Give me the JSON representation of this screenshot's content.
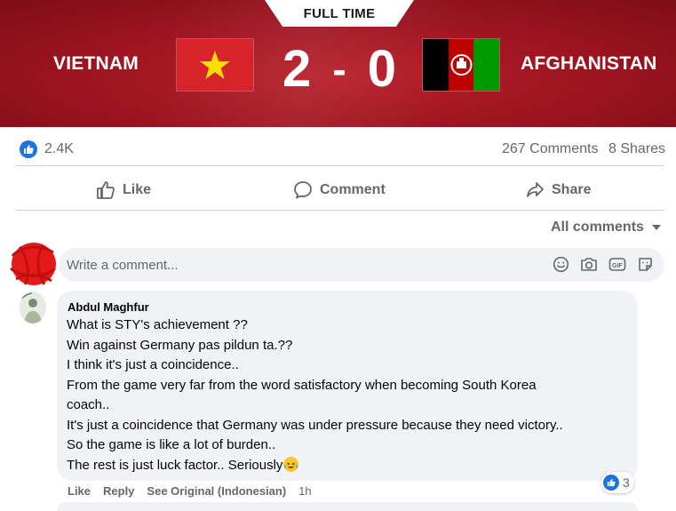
{
  "scoreboard": {
    "status": "FULL TIME",
    "home_team": "VIETNAM",
    "away_team": "AFGHANISTAN",
    "home_score": "2",
    "separator": "-",
    "away_score": "0",
    "colors": {
      "banner": "#9c1420",
      "vietnam_flag_red": "#d8232a",
      "vietnam_flag_star": "#ffde00",
      "afghan_black": "#000000",
      "afghan_red": "#be0000",
      "afghan_green": "#009900"
    }
  },
  "post_stats": {
    "likes": "2.4K",
    "comments": "267 Comments",
    "shares": "8 Shares",
    "like_icon": "thumbs-up-icon",
    "accent": "#1b74e4"
  },
  "actions": {
    "like_label": "Like",
    "comment_label": "Comment",
    "share_label": "Share"
  },
  "comments_section": {
    "sort_label": "All comments",
    "write_placeholder": "Write a comment...",
    "write_icons": [
      "emoji-icon",
      "camera-icon",
      "gif-icon",
      "sticker-icon"
    ]
  },
  "comment": {
    "author": "Abdul Maghfur",
    "lines": [
      "What is STY's achievement ??",
      "Win against Germany pas pildun ta.??",
      "I think it's just a coincidence..",
      "From the game very far from the word satisfactory when becoming South Korea",
      "coach..",
      "It's just a coincidence that Germany was under pressure because they need victory..",
      "So the game is like a lot of burden..",
      "The rest is just luck factor.. Seriously"
    ],
    "like_label": "Like",
    "reply_label": "Reply",
    "see_original_label": "See Original (Indonesian)",
    "time": "1h",
    "reaction_count": "3"
  }
}
